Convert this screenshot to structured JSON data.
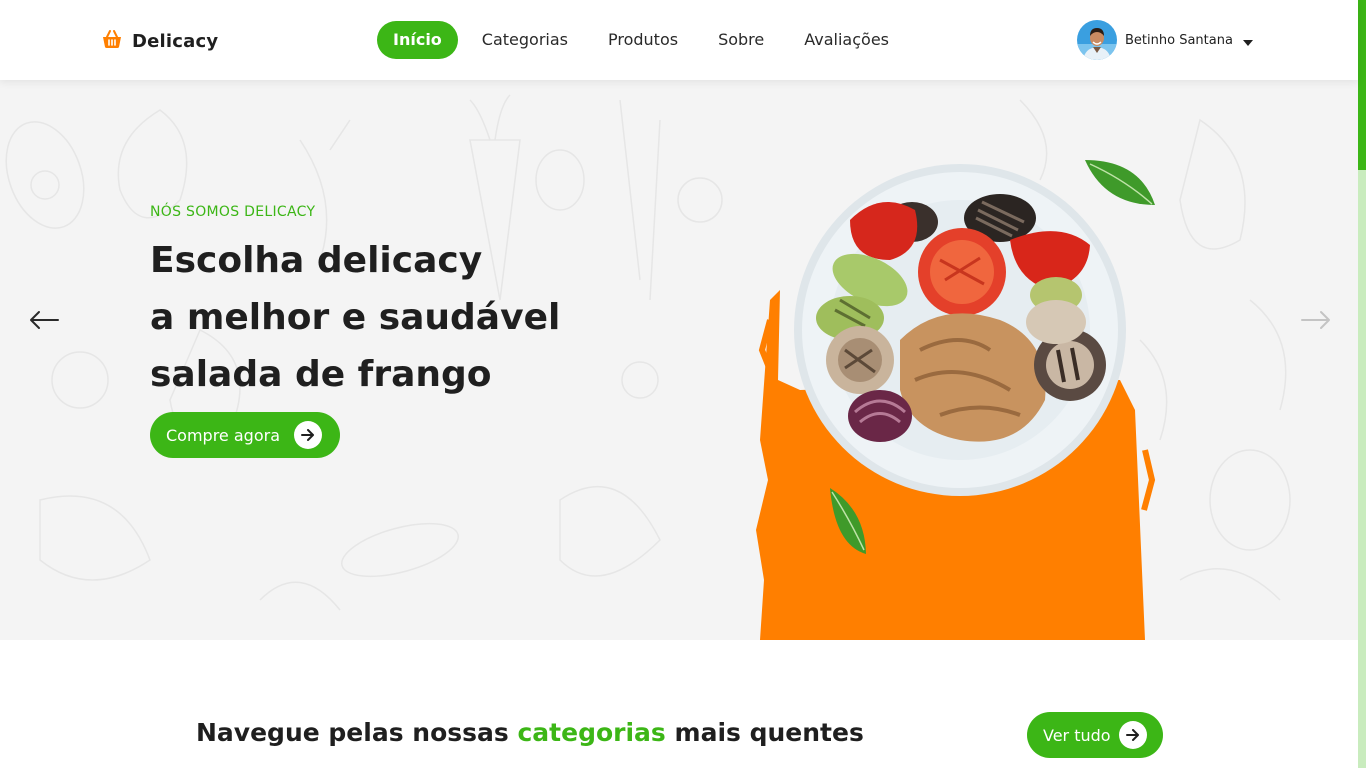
{
  "header": {
    "brand": "Delicacy",
    "logo_icon": "basket-icon",
    "nav": [
      {
        "label": "Início",
        "active": true
      },
      {
        "label": "Categorias",
        "active": false
      },
      {
        "label": "Produtos",
        "active": false
      },
      {
        "label": "Sobre",
        "active": false
      },
      {
        "label": "Avaliações",
        "active": false
      }
    ],
    "user": {
      "name": "Betinho Santana",
      "menu_icon": "caret-down-icon"
    }
  },
  "hero": {
    "eyebrow": "NÓS SOMOS DELICACY",
    "title_lines": [
      "Escolha delicacy",
      "a melhor e saudável",
      "salada de frango"
    ],
    "cta_label": "Compre agora",
    "prev_icon": "arrow-left-icon",
    "next_icon": "arrow-right-icon"
  },
  "categories": {
    "heading_pre": "Navegue pelas nossas",
    "heading_highlight": "categorias",
    "heading_post": "mais quentes",
    "see_all_label": "Ver tudo"
  },
  "colors": {
    "accent": "#3cb616",
    "orange": "#ff7f00",
    "text": "#1f1f1f",
    "hero_bg": "#f4f4f4"
  }
}
